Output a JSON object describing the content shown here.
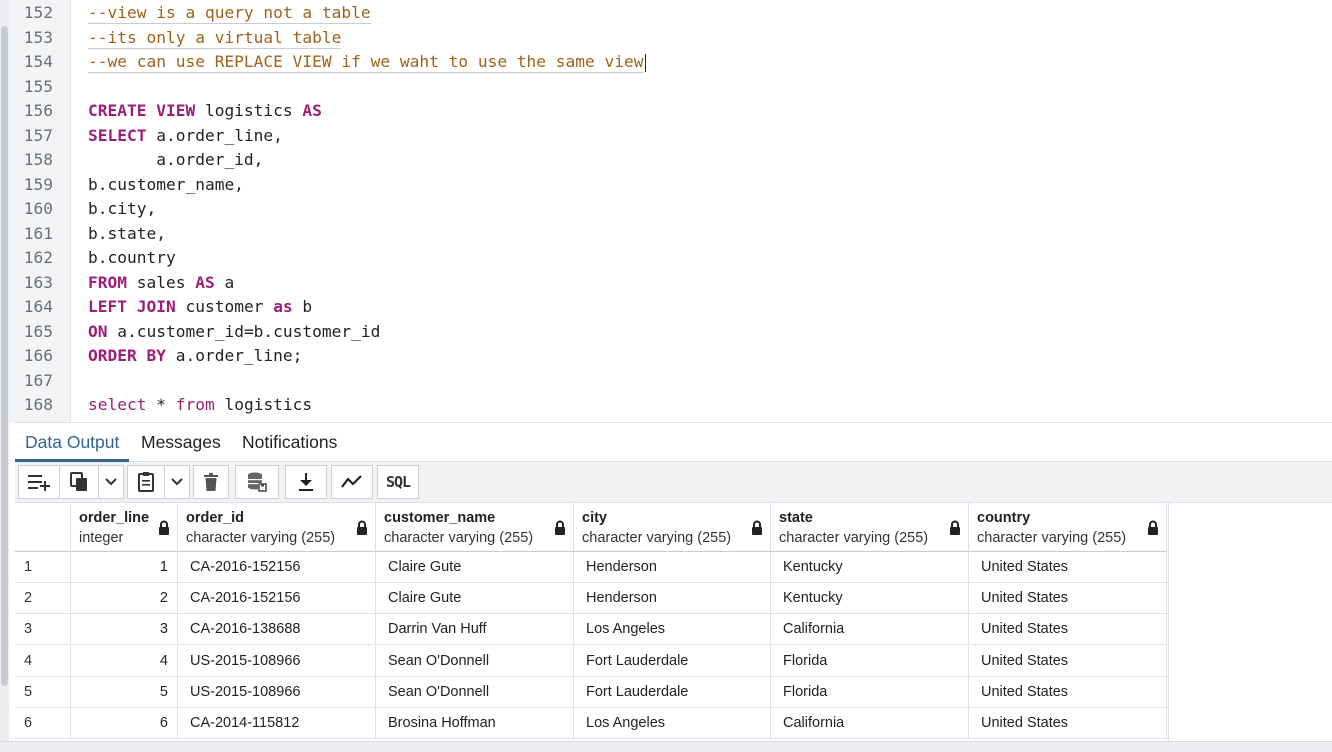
{
  "editor": {
    "lines": [
      {
        "num": "152",
        "segs": [
          {
            "t": "--view is a query not a table",
            "c": "comment"
          }
        ]
      },
      {
        "num": "153",
        "segs": [
          {
            "t": "--its only a virtual table",
            "c": "comment"
          }
        ]
      },
      {
        "num": "154",
        "segs": [
          {
            "t": "--we can use REPLACE VIEW if we waht to use the same view",
            "c": "comment"
          }
        ],
        "caret": true
      },
      {
        "num": "155",
        "segs": []
      },
      {
        "num": "156",
        "segs": [
          {
            "t": "CREATE VIEW",
            "c": "kw"
          },
          {
            "t": " logistics ",
            "c": ""
          },
          {
            "t": "AS",
            "c": "kw"
          }
        ]
      },
      {
        "num": "157",
        "segs": [
          {
            "t": "SELECT",
            "c": "kw"
          },
          {
            "t": " a.order_line,",
            "c": ""
          }
        ]
      },
      {
        "num": "158",
        "segs": [
          {
            "t": "       a.order_id,",
            "c": ""
          }
        ]
      },
      {
        "num": "159",
        "segs": [
          {
            "t": "b.customer_name,",
            "c": ""
          }
        ]
      },
      {
        "num": "160",
        "segs": [
          {
            "t": "b.city,",
            "c": ""
          }
        ]
      },
      {
        "num": "161",
        "segs": [
          {
            "t": "b.state,",
            "c": ""
          }
        ]
      },
      {
        "num": "162",
        "segs": [
          {
            "t": "b.country",
            "c": ""
          }
        ]
      },
      {
        "num": "163",
        "segs": [
          {
            "t": "FROM",
            "c": "kw"
          },
          {
            "t": " sales ",
            "c": ""
          },
          {
            "t": "AS",
            "c": "kw"
          },
          {
            "t": " a",
            "c": ""
          }
        ]
      },
      {
        "num": "164",
        "segs": [
          {
            "t": "LEFT JOIN",
            "c": "kw"
          },
          {
            "t": " customer ",
            "c": ""
          },
          {
            "t": "as",
            "c": "kw"
          },
          {
            "t": " b",
            "c": ""
          }
        ]
      },
      {
        "num": "165",
        "segs": [
          {
            "t": "ON",
            "c": "kw"
          },
          {
            "t": " a.customer_id=b.customer_id",
            "c": ""
          }
        ]
      },
      {
        "num": "166",
        "segs": [
          {
            "t": "ORDER BY",
            "c": "kw"
          },
          {
            "t": " a.order_line;",
            "c": ""
          }
        ]
      },
      {
        "num": "167",
        "segs": []
      },
      {
        "num": "168",
        "segs": [
          {
            "t": "select",
            "c": "kw2"
          },
          {
            "t": " * ",
            "c": ""
          },
          {
            "t": "from",
            "c": "kw2"
          },
          {
            "t": " logistics",
            "c": ""
          }
        ]
      }
    ]
  },
  "results": {
    "tabs": [
      {
        "label": "Data Output",
        "active": true
      },
      {
        "label": "Messages",
        "active": false
      },
      {
        "label": "Notifications",
        "active": false
      }
    ],
    "toolbar": {
      "sql_label": "SQL"
    },
    "columns": [
      {
        "name": "order_line",
        "type": "integer"
      },
      {
        "name": "order_id",
        "type": "character varying (255)"
      },
      {
        "name": "customer_name",
        "type": "character varying (255)"
      },
      {
        "name": "city",
        "type": "character varying (255)"
      },
      {
        "name": "state",
        "type": "character varying (255)"
      },
      {
        "name": "country",
        "type": "character varying (255)"
      }
    ],
    "rows": [
      {
        "n": "1",
        "cells": [
          "1",
          "CA-2016-152156",
          "Claire Gute",
          "Henderson",
          "Kentucky",
          "United States"
        ]
      },
      {
        "n": "2",
        "cells": [
          "2",
          "CA-2016-152156",
          "Claire Gute",
          "Henderson",
          "Kentucky",
          "United States"
        ]
      },
      {
        "n": "3",
        "cells": [
          "3",
          "CA-2016-138688",
          "Darrin Van Huff",
          "Los Angeles",
          "California",
          "United States"
        ]
      },
      {
        "n": "4",
        "cells": [
          "4",
          "US-2015-108966",
          "Sean O'Donnell",
          "Fort Lauderdale",
          "Florida",
          "United States"
        ]
      },
      {
        "n": "5",
        "cells": [
          "5",
          "US-2015-108966",
          "Sean O'Donnell",
          "Fort Lauderdale",
          "Florida",
          "United States"
        ]
      },
      {
        "n": "6",
        "cells": [
          "6",
          "CA-2014-115812",
          "Brosina Hoffman",
          "Los Angeles",
          "California",
          "United States"
        ]
      }
    ]
  },
  "icons": {
    "add_row": "add-row-icon",
    "copy": "copy-icon",
    "paste": "paste-icon",
    "delete": "delete-icon",
    "save_data": "save-data-icon",
    "download": "download-icon",
    "graph": "graph-visualiser-icon",
    "lock": "lock-icon"
  },
  "colors": {
    "keyword": "#9b1f7a",
    "comment": "#a0621a",
    "active_tab": "#326690"
  }
}
